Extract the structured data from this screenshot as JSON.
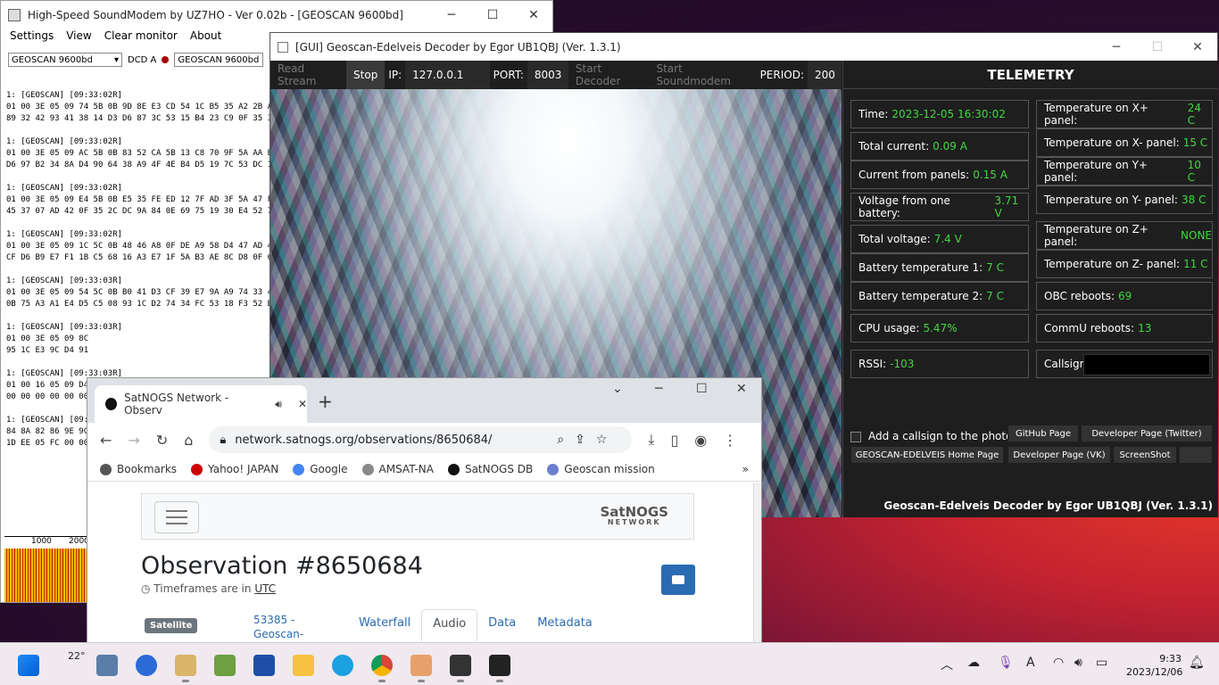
{
  "soundmodem": {
    "title": "High-Speed SoundModem by UZ7HO - Ver 0.02b - [GEOSCAN 9600bd]",
    "menu": [
      "Settings",
      "View",
      "Clear monitor",
      "About"
    ],
    "mode_a": "GEOSCAN 9600bd",
    "dcd_label": "DCD A",
    "mode_b": "GEOSCAN 9600bd",
    "monitor_lines": [
      "1: [GEOSCAN] [09:33:02R]",
      "01 00 3E 05 09 74 5B 0B 9D 8E E3 CD 54 1C B5 35 A2 2B A9",
      "89 32 42 93 41 38 14 D3 D6 87 3C 53 15 B4 23 C9 0F 35 32 6",
      "",
      "1: [GEOSCAN] [09:33:02R]",
      "01 00 3E 05 09 AC 5B 0B 83 52 CA 5B 13 C8 70 9F 5A AA E6",
      "D6 97 B2 34 8A D4 90 64 38 A9 4F 4E B4 D5 19 7C 53 DC 1A",
      "",
      "1: [GEOSCAN] [09:33:02R]",
      "01 00 3E 05 09 E4 5B 0B E5 35 FE ED 12 7F AD 3F 5A 47 FB E",
      "45 37 07 AD 42 0F 35 2C DC 9A 84 0E 69 75 19 30 E4 52 77 A",
      "",
      "1: [GEOSCAN] [09:33:02R]",
      "01 00 3E 05 09 1C 5C 0B 48 46 A8 0F DE A9 58 D4 47 AD 42",
      "CF D6 B9 E7 F1 1B C5 68 16 A3 E7 1F 5A B3 AE 8C D8 0F 63",
      "",
      "1: [GEOSCAN] [09:33:03R]",
      "01 00 3E 05 09 54 5C 0B B0 41 D3 CF 39 E7 9A A9 74 33 48 E",
      "0B 75 A3 A1 E4 D5 C5 08 93 1C D2 74 34 FC 53 18 F3 52 B4 C",
      "",
      "1: [GEOSCAN] [09:33:03R]",
      "01 00 3E 05 09 8C",
      "95 1C E3 9C D4 91",
      "",
      "1: [GEOSCAN] [09:33:03R]",
      "01 00 16 05 09 D4",
      "00 00 00 00 00 00",
      "",
      "1: [GEOSCAN] [09:33:03R]",
      "84 8A 82 86 9E 9C",
      "1D EE 05 FC 00 00"
    ],
    "scale": [
      "1000",
      "2000"
    ]
  },
  "decoder": {
    "title": "[GUI] Geoscan-Edelveis Decoder by Egor UB1QBJ (Ver. 1.3.1)",
    "buttons": {
      "read": "Read Stream",
      "stop": "Stop",
      "start_dec": "Start Decoder",
      "start_sm": "Start Soundmodem"
    },
    "ip_label": "IP:",
    "ip": "127.0.0.1",
    "port_label": "PORT:",
    "port": "8003",
    "period_label": "PERIOD:",
    "period": "200",
    "telemetry_title": "TELEMETRY",
    "left": [
      {
        "label": "Time:",
        "value": "2023-12-05 16:30:02"
      },
      {
        "label": "Total current:",
        "value": "0.09 A"
      },
      {
        "label": "Current from panels:",
        "value": "0.15 A"
      },
      {
        "label": "Voltage from one battery:",
        "value": "3.71 V"
      },
      {
        "label": "Total voltage:",
        "value": "7.4 V"
      },
      {
        "label": "Battery temperature 1:",
        "value": "7 C"
      },
      {
        "label": "Battery temperature 2:",
        "value": "7 C"
      },
      {
        "label": "CPU usage:",
        "value": "5.47%"
      },
      {
        "label": "RSSI:",
        "value": "-103"
      }
    ],
    "right": [
      {
        "label": "Temperature on X+ panel:",
        "value": "24 C"
      },
      {
        "label": "Temperature on X- panel:",
        "value": "15 C"
      },
      {
        "label": "Temperature on Y+ panel:",
        "value": "10 C"
      },
      {
        "label": "Temperature on Y- panel:",
        "value": "38 C"
      },
      {
        "label": "Temperature on Z+ panel:",
        "value": "NONE"
      },
      {
        "label": "Temperature on Z- panel:",
        "value": "11 C"
      },
      {
        "label": "OBC reboots:",
        "value": "69"
      },
      {
        "label": "CommU reboots:",
        "value": "13"
      },
      {
        "label": "Callsign:",
        "value": ""
      }
    ],
    "add_callsign": "Add a callsign to the photo?",
    "links": [
      "GitHub Page",
      "Developer Page (Twitter)",
      "GEOSCAN-EDELVEIS Home Page",
      "Developer Page (VK)",
      "ScreenShot"
    ],
    "footer": "Geoscan-Edelveis Decoder by Egor UB1QBJ (Ver. 1.3.1)"
  },
  "chrome": {
    "tab_title": "SatNOGS Network - Observ",
    "url": "network.satnogs.org/observations/8650684/",
    "bookmarks": [
      "Bookmarks",
      "Yahoo! JAPAN",
      "Google",
      "AMSAT-NA",
      "SatNOGS DB",
      "Geoscan mission"
    ],
    "logo_top": "SatNOGS",
    "logo_bottom": "NETWORK",
    "heading": "Observation #8650684",
    "timeframe_prefix": "Timeframes are in",
    "timeframe_tz": "UTC",
    "satellite_badge": "Satellite",
    "satellite_link": "53385 - Geoscan-Edelveis",
    "tabs": [
      "Waterfall",
      "Audio",
      "Data",
      "Metadata"
    ]
  },
  "taskbar": {
    "weather": "22°",
    "time": "9:33",
    "date": "2023/12/06"
  },
  "colors": {
    "telemetry_value": "#3fd93f",
    "accent": "#2a6bb3"
  }
}
